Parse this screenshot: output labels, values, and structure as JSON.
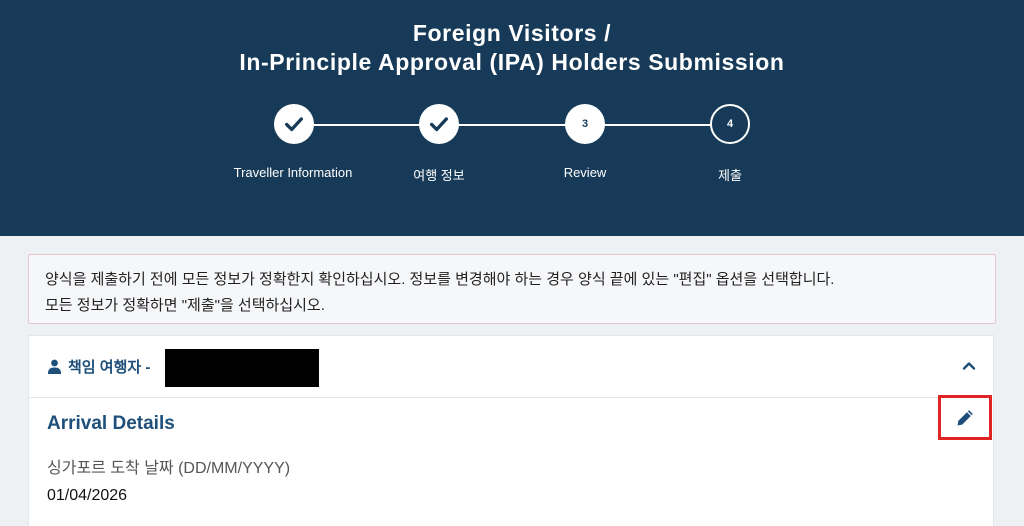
{
  "header": {
    "title_line1": "Foreign Visitors /",
    "title_line2": "In-Principle Approval (IPA) Holders Submission"
  },
  "stepper": {
    "steps": [
      {
        "label": "Traveller Information",
        "status": "completed",
        "icon": "check-icon"
      },
      {
        "label": "여행 정보",
        "status": "completed",
        "icon": "check-icon"
      },
      {
        "label": "Review",
        "status": "current",
        "number": "3"
      },
      {
        "label": "제출",
        "status": "pending",
        "number": "4"
      }
    ]
  },
  "notice": {
    "line1": "양식을 제출하기 전에 모든 정보가 정확한지 확인하십시오. 정보를 변경해야 하는 경우 양식 끝에 있는 \"편집\" 옵션을 선택합니다.",
    "line2": "모든 정보가 정확하면 \"제출\"을 선택하십시오."
  },
  "traveller_panel": {
    "heading": "책임 여행자 -",
    "icon": "person-icon",
    "collapse_icon": "chevron-up-icon"
  },
  "arrival": {
    "title": "Arrival Details",
    "edit_icon": "pencil-icon",
    "date_label": "싱가포르 도착 날짜 (DD/MM/YYYY)",
    "date_value": "01/04/2026"
  },
  "colors": {
    "header_bg": "#163a57",
    "accent_text": "#1d4f7a",
    "highlight_border": "#e02424",
    "page_bg": "#eef1f4"
  }
}
